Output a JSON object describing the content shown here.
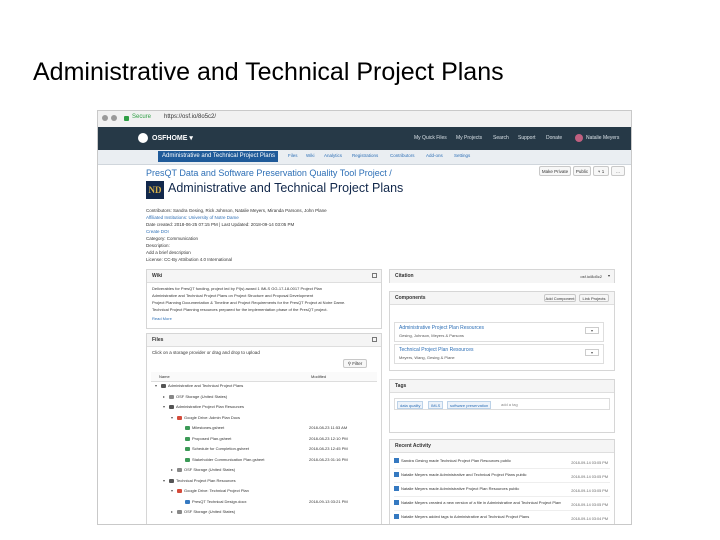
{
  "slide": {
    "title": "Administrative and Technical Project Plans"
  },
  "browser": {
    "secure_label": "Secure",
    "url": "https://osf.io/8o5c2/"
  },
  "osf_nav": {
    "brand": "OSFHOME",
    "links": [
      "My Quick Files",
      "My Projects",
      "Search",
      "Support",
      "Donate"
    ],
    "user": "Natalie Meyers"
  },
  "project_nav": {
    "active": "Administrative and Technical Project Plans",
    "tabs": [
      "Files",
      "Wiki",
      "Analytics",
      "Registrations",
      "Contributors",
      "Add-ons",
      "Settings"
    ]
  },
  "actions": {
    "make_private": "Make Private",
    "public": "Public",
    "fork_count": "1",
    "more": "..."
  },
  "header": {
    "parent_link": "PresQT Data and Software Preservation Quality Tool Project /",
    "nd_logo": "ND",
    "title": "Administrative and Technical Project Plans",
    "contributors": "Contributors: Sandra Gesing, Rick Johnson, Natalie Meyers, Miranda Parsons, John Plane",
    "affiliation": "Affiliated Institutions: University of Notre Dame",
    "date_created": "Date created: 2018-06-25 07:15 PM | Last Updated: 2018-09-14 03:05 PM",
    "doi": "Create DOI",
    "category": "Category: Communication",
    "description": "Description:",
    "description_link": "Add a brief description",
    "license": "License: CC-By Attribution 4.0 International"
  },
  "wiki": {
    "title": "Wiki",
    "lines": [
      "Deliverables for PresQT funding, project led by PI(s) award 1 IMLS GG-17-18-0017 Project Plan",
      "Administrative and Technical Project Plans on Project Structure and Proposal Development",
      "Project Planning Documentation & Timeline and Project Requirements for the PresQT Project at Notre Dame.",
      "Technical Project Planning resources prepared for the implementation phase of the PresQT project."
    ],
    "read_more": "Read More"
  },
  "files": {
    "title": "Files",
    "hint": "Click on a storage provider or drag and drop to upload",
    "filter": "Filter",
    "col_name": "Name",
    "col_modified": "Modified",
    "rows": [
      {
        "toggle": "▾",
        "color": "#555555",
        "indent": 0,
        "name": "Administrative and Technical Project Plans",
        "date": ""
      },
      {
        "toggle": "▸",
        "color": "#888888",
        "indent": 1,
        "name": "OSF Storage (United States)",
        "date": ""
      },
      {
        "toggle": "▾",
        "color": "#555555",
        "indent": 1,
        "name": "Administrative Project Plan Resources",
        "date": ""
      },
      {
        "toggle": "▾",
        "color": "#d44b3a",
        "indent": 2,
        "name": "Google Drive: Admin Plan Docs",
        "date": ""
      },
      {
        "toggle": "",
        "color": "#3c9a57",
        "indent": 3,
        "name": "Milestones.gsheet",
        "date": "2018-08-23 11:53 AM"
      },
      {
        "toggle": "",
        "color": "#3c9a57",
        "indent": 3,
        "name": "Proposed Plan.gsheet",
        "date": "2018-08-23 12:10 PM"
      },
      {
        "toggle": "",
        "color": "#3c9a57",
        "indent": 3,
        "name": "Schedule for Completion.gsheet",
        "date": "2018-08-23 12:45 PM"
      },
      {
        "toggle": "",
        "color": "#3c9a57",
        "indent": 3,
        "name": "Stakeholder Communication Plan.gsheet",
        "date": "2018-08-23 01:16 PM"
      },
      {
        "toggle": "▸",
        "color": "#888888",
        "indent": 2,
        "name": "OSF Storage (United States)",
        "date": ""
      },
      {
        "toggle": "▾",
        "color": "#555555",
        "indent": 1,
        "name": "Technical Project Plan Resources",
        "date": ""
      },
      {
        "toggle": "▾",
        "color": "#d44b3a",
        "indent": 2,
        "name": "Google Drive: Technical Project Plan",
        "date": ""
      },
      {
        "toggle": "",
        "color": "#3579c1",
        "indent": 3,
        "name": "PresQT Technical Design.docx",
        "date": "2018-09-13 03:21 PM"
      },
      {
        "toggle": "▸",
        "color": "#888888",
        "indent": 2,
        "name": "OSF Storage (United States)",
        "date": ""
      }
    ]
  },
  "citation": {
    "title": "Citation",
    "id": "osf.io/8o5c2"
  },
  "components": {
    "title": "Components",
    "add_component": "Add Component",
    "link_projects": "Link Projects",
    "items": [
      {
        "name": "Administrative Project Plan Resources",
        "authors": "Gesing, Johnson, Meyers & Parsons",
        "button": "▾"
      },
      {
        "name": "Technical Project Plan Resources",
        "authors": "Meyers, Wang, Gesing & Plane",
        "button": "▾"
      }
    ]
  },
  "tags": {
    "title": "Tags",
    "items": [
      "data quality",
      "IMLS",
      "software preservation"
    ],
    "add": "add a tag"
  },
  "activity": {
    "title": "Recent Activity",
    "items": [
      {
        "text": "Sandra Gesing made Technical Project Plan Resources public",
        "time": "2018-09-14 03:05 PM"
      },
      {
        "text": "Natalie Meyers made Administrative and Technical Project Plans public",
        "time": "2018-09-14 03:05 PM"
      },
      {
        "text": "Natalie Meyers made Administrative Project Plan Resources public",
        "time": "2018-09-14 03:05 PM"
      },
      {
        "text": "Natalie Meyers created a new version of a file in Administrative and Technical Project Plans",
        "time": "2018-09-14 03:05 PM"
      },
      {
        "text": "Natalie Meyers added tags to Administrative and Technical Project Plans",
        "time": "2018-09-14 03:04 PM"
      }
    ]
  }
}
